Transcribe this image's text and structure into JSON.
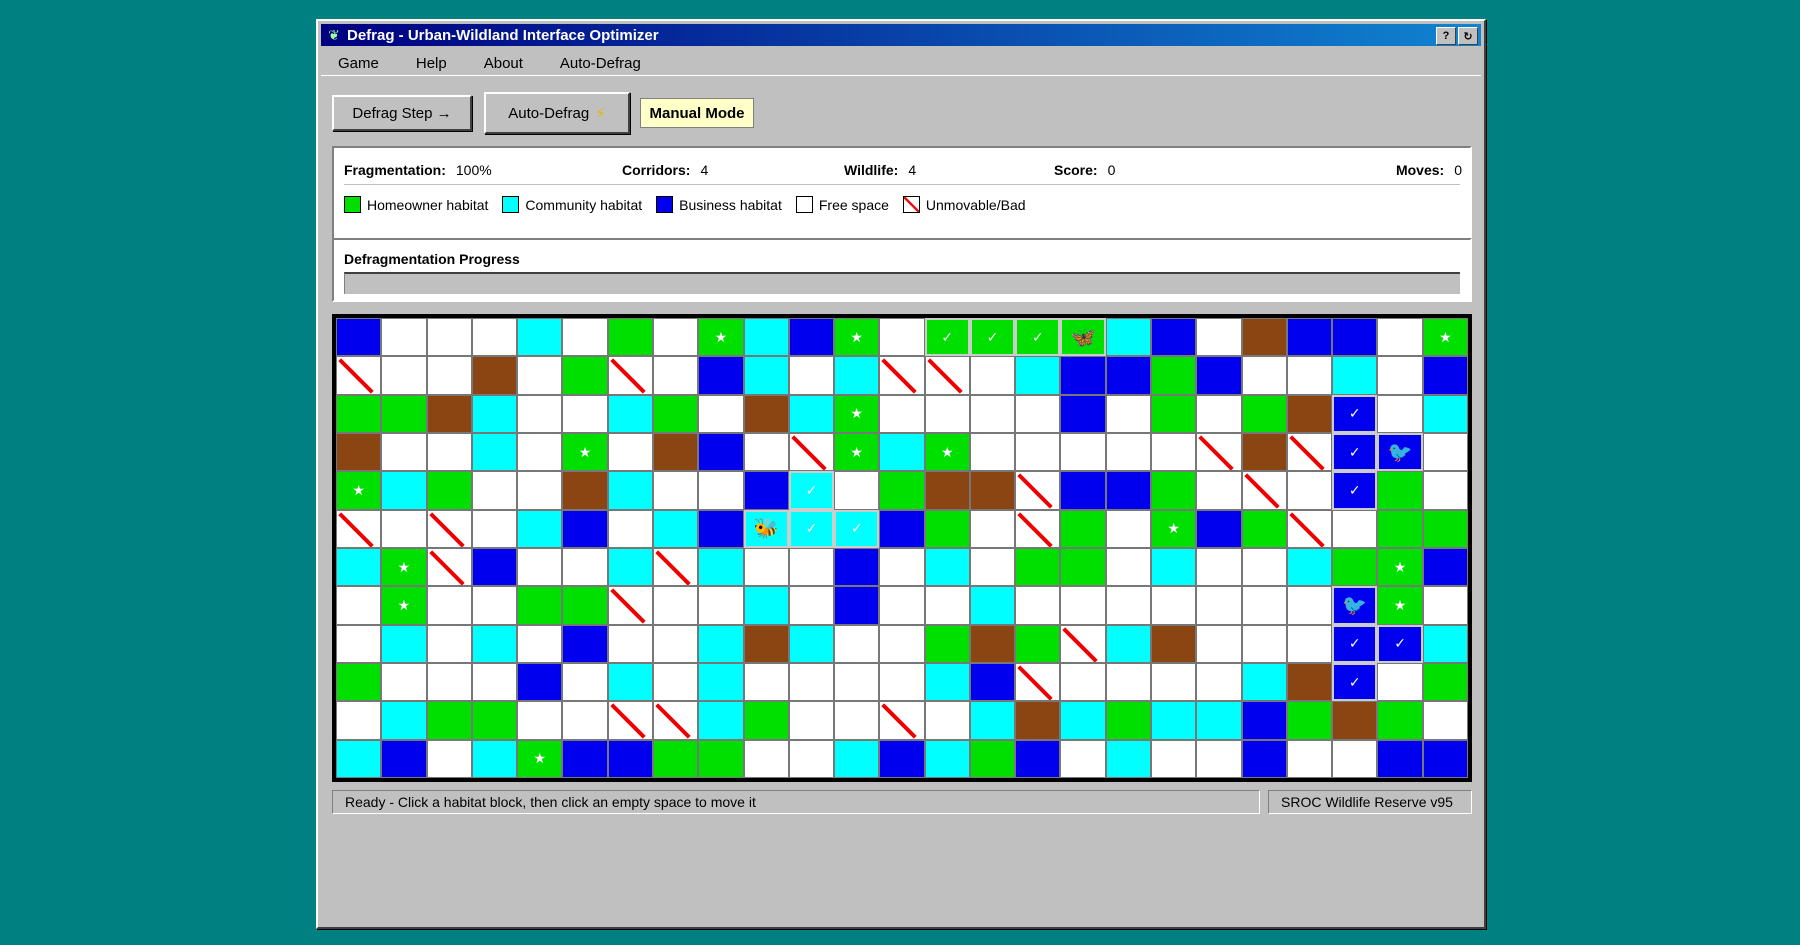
{
  "window": {
    "title": "Defrag - Urban-Wildland Interface Optimizer",
    "help_button": "?",
    "restore_button": "↻"
  },
  "menu": [
    "Game",
    "Help",
    "About",
    "Auto-Defrag"
  ],
  "toolbar": {
    "step_label": "Defrag Step →",
    "auto_label": "Auto-Defrag",
    "auto_icon": "⚡",
    "mode_label": "Manual Mode"
  },
  "stats": {
    "fragmentation_label": "Fragmentation:",
    "fragmentation_value": "100%",
    "corridors_label": "Corridors:",
    "corridors_value": "4",
    "wildlife_label": "Wildlife:",
    "wildlife_value": "4",
    "score_label": "Score:",
    "score_value": "0",
    "moves_label": "Moves:",
    "moves_value": "0"
  },
  "legend": [
    {
      "label": "Homeowner habitat",
      "color": "#00e000"
    },
    {
      "label": "Community habitat",
      "color": "#00ffff"
    },
    {
      "label": "Business habitat",
      "color": "#0000ee"
    },
    {
      "label": "Free space",
      "color": "#ffffff"
    },
    {
      "label": "Unmovable/Bad",
      "color": "bad"
    }
  ],
  "progress": {
    "label": "Defragmentation Progress",
    "percent": 0
  },
  "board": {
    "cols": 25,
    "rows": 12,
    "colors": {
      "G": "#00e000",
      "C": "#00ffff",
      "B": "#0000ee",
      "W": "#ffffff",
      "D": "#8b4513",
      "X": "bad"
    },
    "grid": [
      [
        "B",
        "W",
        "W",
        "W",
        "C",
        "W",
        "G",
        "W",
        "G",
        "C",
        "B",
        "G",
        "W",
        "G",
        "G",
        "G",
        "G",
        "C",
        "B",
        "W",
        "D",
        "B",
        "B",
        "W",
        "G"
      ],
      [
        "X",
        "W",
        "W",
        "D",
        "W",
        "G",
        "X",
        "W",
        "B",
        "C",
        "W",
        "C",
        "X",
        "X",
        "W",
        "C",
        "B",
        "B",
        "G",
        "B",
        "W",
        "W",
        "C",
        "W",
        "B"
      ],
      [
        "G",
        "G",
        "D",
        "C",
        "W",
        "W",
        "C",
        "G",
        "W",
        "D",
        "C",
        "G",
        "W",
        "W",
        "W",
        "W",
        "B",
        "W",
        "G",
        "W",
        "G",
        "D",
        "B",
        "W",
        "C"
      ],
      [
        "D",
        "W",
        "W",
        "C",
        "W",
        "G",
        "W",
        "D",
        "B",
        "W",
        "X",
        "G",
        "C",
        "G",
        "W",
        "W",
        "W",
        "W",
        "W",
        "X",
        "D",
        "X",
        "B",
        "B",
        "W"
      ],
      [
        "G",
        "C",
        "G",
        "W",
        "W",
        "D",
        "C",
        "W",
        "W",
        "B",
        "C",
        "W",
        "G",
        "D",
        "D",
        "X",
        "B",
        "B",
        "G",
        "W",
        "X",
        "W",
        "B",
        "G",
        "W"
      ],
      [
        "X",
        "W",
        "X",
        "W",
        "C",
        "B",
        "W",
        "C",
        "B",
        "C",
        "C",
        "C",
        "B",
        "G",
        "W",
        "X",
        "G",
        "W",
        "G",
        "B",
        "G",
        "X",
        "W",
        "G",
        "G"
      ],
      [
        "C",
        "G",
        "X",
        "B",
        "W",
        "W",
        "C",
        "X",
        "C",
        "W",
        "W",
        "B",
        "W",
        "C",
        "W",
        "G",
        "G",
        "W",
        "C",
        "W",
        "W",
        "C",
        "G",
        "G",
        "B"
      ],
      [
        "W",
        "G",
        "W",
        "W",
        "G",
        "G",
        "X",
        "W",
        "W",
        "C",
        "W",
        "B",
        "W",
        "W",
        "C",
        "W",
        "W",
        "W",
        "W",
        "W",
        "W",
        "W",
        "B",
        "G",
        "W"
      ],
      [
        "W",
        "C",
        "W",
        "C",
        "W",
        "B",
        "W",
        "W",
        "C",
        "D",
        "C",
        "W",
        "W",
        "G",
        "D",
        "G",
        "X",
        "C",
        "D",
        "W",
        "W",
        "W",
        "B",
        "B",
        "C"
      ],
      [
        "G",
        "W",
        "W",
        "W",
        "B",
        "W",
        "C",
        "W",
        "C",
        "W",
        "W",
        "W",
        "W",
        "C",
        "B",
        "X",
        "W",
        "W",
        "W",
        "W",
        "C",
        "D",
        "B",
        "W",
        "G"
      ],
      [
        "W",
        "C",
        "G",
        "G",
        "W",
        "W",
        "X",
        "X",
        "C",
        "G",
        "W",
        "W",
        "X",
        "W",
        "C",
        "D",
        "C",
        "G",
        "C",
        "C",
        "B",
        "G",
        "D",
        "G",
        "W"
      ],
      [
        "C",
        "B",
        "W",
        "C",
        "G",
        "B",
        "B",
        "G",
        "G",
        "W",
        "W",
        "C",
        "B",
        "C",
        "G",
        "B",
        "W",
        "C",
        "W",
        "W",
        "B",
        "W",
        "W",
        "B",
        "B"
      ]
    ],
    "stars": [
      [
        0,
        8
      ],
      [
        0,
        11
      ],
      [
        0,
        24
      ],
      [
        2,
        11
      ],
      [
        3,
        5
      ],
      [
        3,
        11
      ],
      [
        3,
        13
      ],
      [
        4,
        0
      ],
      [
        5,
        18
      ],
      [
        6,
        1
      ],
      [
        6,
        23
      ],
      [
        7,
        1
      ],
      [
        7,
        23
      ],
      [
        11,
        4
      ]
    ],
    "checks": [
      [
        0,
        13
      ],
      [
        0,
        14
      ],
      [
        0,
        15
      ],
      [
        2,
        22
      ],
      [
        3,
        22
      ],
      [
        4,
        10
      ],
      [
        4,
        22
      ],
      [
        5,
        10
      ],
      [
        5,
        11
      ],
      [
        8,
        22
      ],
      [
        8,
        23
      ],
      [
        9,
        22
      ]
    ],
    "corridor_cells": [
      [
        0,
        13
      ],
      [
        0,
        14
      ],
      [
        0,
        15
      ],
      [
        0,
        16
      ],
      [
        2,
        22
      ],
      [
        3,
        22
      ],
      [
        3,
        23
      ],
      [
        4,
        10
      ],
      [
        4,
        22
      ],
      [
        5,
        9
      ],
      [
        5,
        10
      ],
      [
        5,
        11
      ],
      [
        7,
        22
      ],
      [
        8,
        22
      ],
      [
        8,
        23
      ],
      [
        9,
        22
      ]
    ],
    "creatures": [
      {
        "row": 0,
        "col": 16,
        "icon": "🦋",
        "name": "butterfly-icon"
      },
      {
        "row": 3,
        "col": 23,
        "icon": "🐦",
        "name": "bird-icon"
      },
      {
        "row": 5,
        "col": 9,
        "icon": "🐝",
        "name": "bee-icon"
      },
      {
        "row": 7,
        "col": 22,
        "icon": "🐦",
        "name": "bird-icon"
      }
    ]
  },
  "status": {
    "message": "Ready - Click a habitat block, then click an empty space to move it",
    "version": "SROC Wildlife Reserve v95"
  }
}
